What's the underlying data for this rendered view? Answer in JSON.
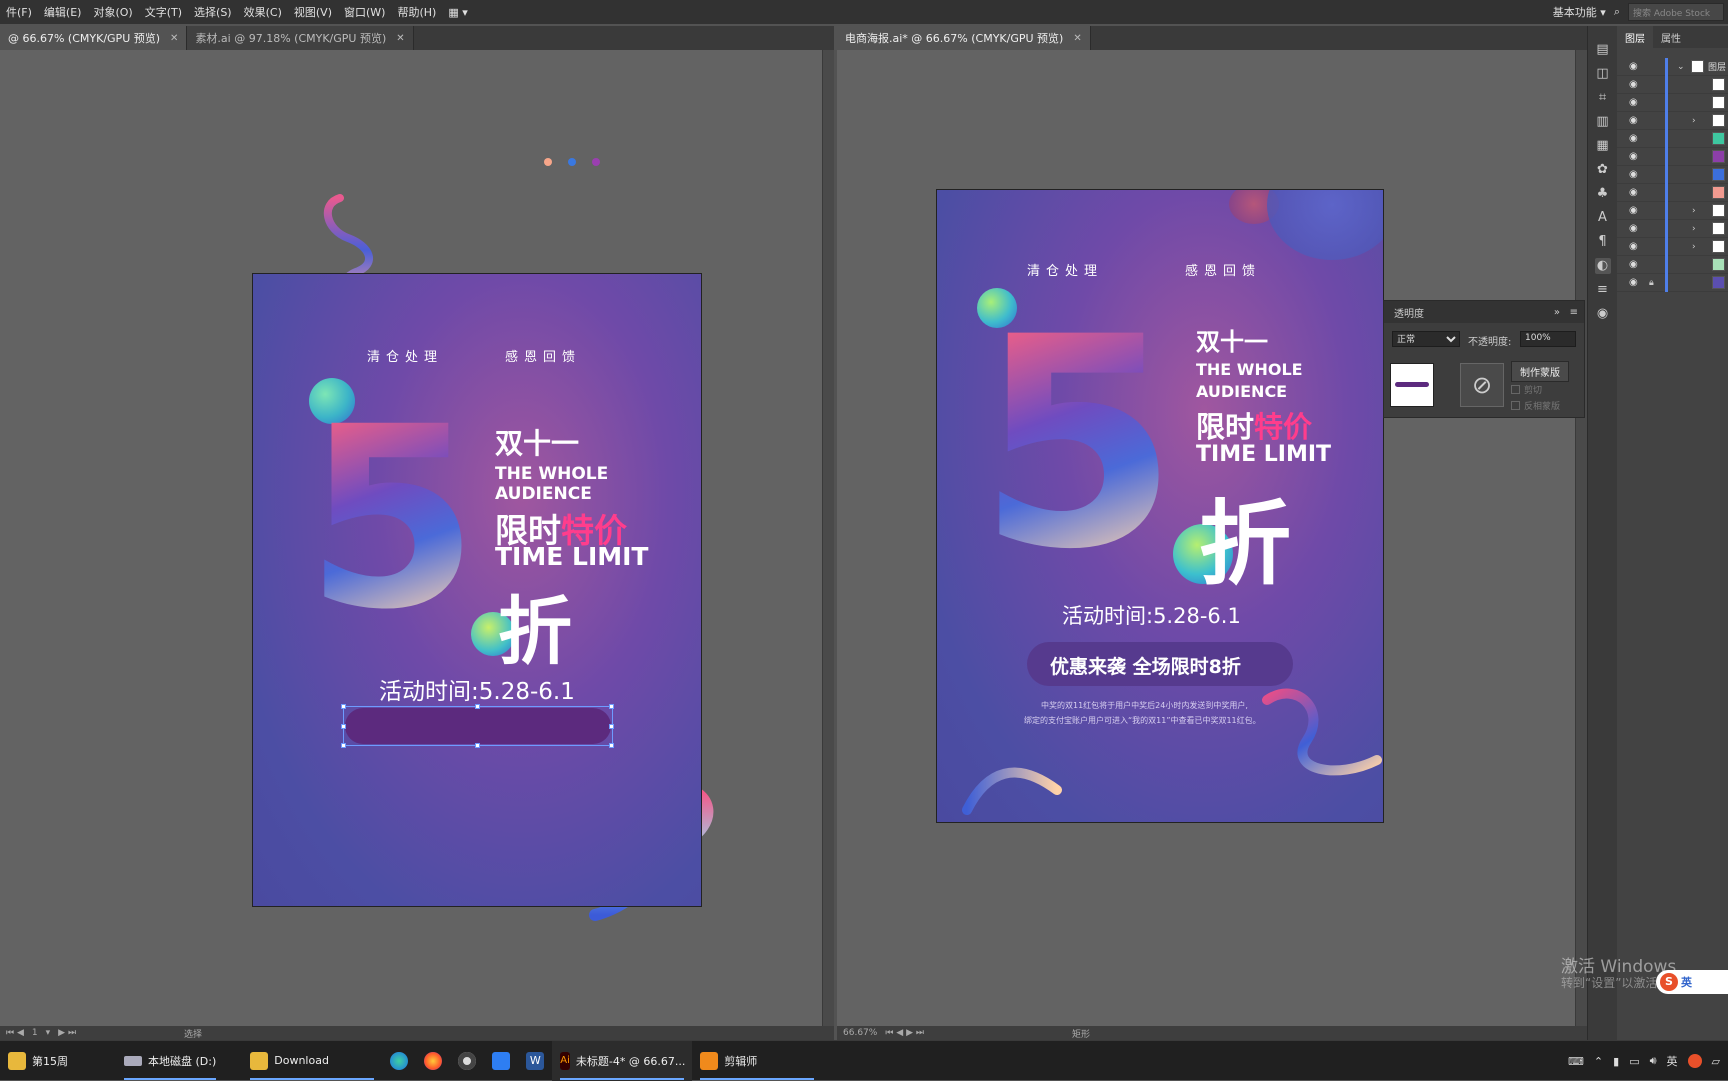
{
  "menubar": {
    "items": [
      "件(F)",
      "编辑(E)",
      "对象(O)",
      "文字(T)",
      "选择(S)",
      "效果(C)",
      "视图(V)",
      "窗口(W)",
      "帮助(H)"
    ],
    "workspace": "基本功能",
    "search_placeholder": "搜索 Adobe Stock"
  },
  "left_doc": {
    "tabs": [
      {
        "label": "@ 66.67% (CMYK/GPU 预览)",
        "active": true
      },
      {
        "label": "素材.ai @ 97.18% (CMYK/GPU 预览)",
        "active": false
      }
    ],
    "status_page": "1",
    "status_tool": "选择"
  },
  "right_doc": {
    "tabs": [
      {
        "label": "电商海报.ai* @ 66.67% (CMYK/GPU 预览)",
        "active": true
      }
    ],
    "status_zoom": "66.67%",
    "status_tool": "矩形"
  },
  "poster": {
    "sub1": "清仓处理",
    "sub2": "感恩回馈",
    "digit": "5",
    "line1": "双十一",
    "line2": "THE WHOLE",
    "line3": "AUDIENCE",
    "line4a": "限时",
    "line4b": "特价",
    "line5": "TIME LIMIT",
    "zhe": "折",
    "time": "活动时间:5.28-6.1",
    "pill": "优惠来袭 全场限时8折",
    "note1": "中奖的双11红包将于用户中奖后24小时内发送到中奖用户,",
    "note2": "绑定的支付宝账户用户可进入“我的双11”中查看已中奖双11红包。"
  },
  "transparency_panel": {
    "title": "透明度",
    "blend_mode": "正常",
    "opacity_label": "不透明度:",
    "opacity_value": "100%",
    "make_mask": "制作蒙版",
    "clip": "剪切",
    "invert": "反相蒙版"
  },
  "layers_panel": {
    "tab_layers": "图层",
    "tab_properties": "属性",
    "top_layer": "图层",
    "row_count": 12
  },
  "taskbar": {
    "items": [
      {
        "label": "第15周",
        "active": false
      },
      {
        "label": "本地磁盘 (D:)",
        "active": true
      },
      {
        "label": "Download",
        "active": true
      },
      {
        "label": "",
        "active": false
      },
      {
        "label": "",
        "active": false
      },
      {
        "label": "",
        "active": false
      },
      {
        "label": "",
        "active": false
      },
      {
        "label": "",
        "active": false
      },
      {
        "label": "未标题-4* @ 66.67...",
        "active": true
      },
      {
        "label": "剪辑师",
        "active": true
      }
    ],
    "ime": "英"
  },
  "watermark": {
    "line1": "激活 Windows",
    "line2": "转到“设置”以激活"
  },
  "colors": {
    "accent": "#4f7fe9",
    "poster_pink": "#ff3d8c",
    "pill_purple": "#5c2a7e"
  }
}
